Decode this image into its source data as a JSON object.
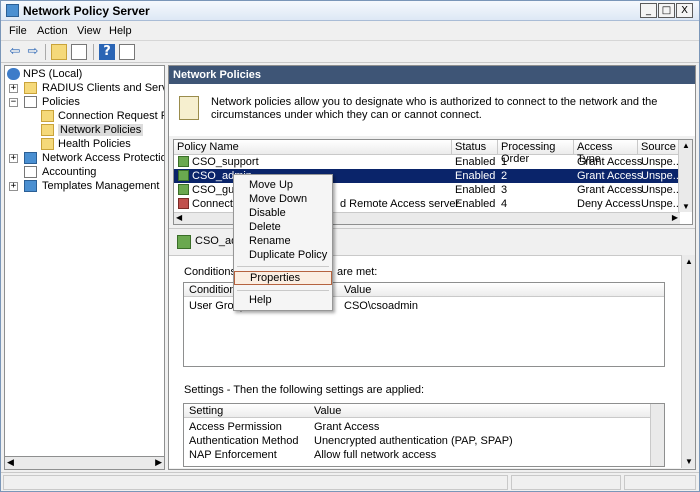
{
  "window": {
    "title": "Network Policy Server",
    "controls": [
      "_",
      "□",
      "X"
    ]
  },
  "menu": [
    "File",
    "Action",
    "View",
    "Help"
  ],
  "tree": {
    "items": [
      {
        "label": "NPS (Local)"
      },
      {
        "label": "RADIUS Clients and Servers"
      },
      {
        "label": "Policies"
      },
      {
        "label": "Connection Request Polici"
      },
      {
        "label": "Network Policies"
      },
      {
        "label": "Health Policies"
      },
      {
        "label": "Network Access Protection"
      },
      {
        "label": "Accounting"
      },
      {
        "label": "Templates Management"
      }
    ]
  },
  "main": {
    "header": "Network Policies",
    "description": "Network policies allow you to designate who is authorized to connect to the network and the circumstances under which they can or cannot connect.",
    "columns": [
      "Policy Name",
      "Status",
      "Processing Order",
      "Access Type",
      "Source"
    ],
    "rows": [
      {
        "name": "CSO_support",
        "status": "Enabled",
        "order": "1",
        "access": "Grant Access",
        "source": "Unspe..."
      },
      {
        "name": "CSO_admin",
        "status": "Enabled",
        "order": "2",
        "access": "Grant Access",
        "source": "Unspe..."
      },
      {
        "name": "CSO_guest",
        "status": "Enabled",
        "order": "3",
        "access": "Grant Access",
        "source": "Unspe..."
      },
      {
        "name": "Connection",
        "name_tail": "d Remote Access server",
        "status": "Enabled",
        "order": "4",
        "access": "Deny Access",
        "source": "Unspe..."
      }
    ],
    "detail": {
      "title": "CSO_adm",
      "conditions_label_tail": "are met:",
      "conditions_prefix": "Conditions -",
      "conditions_columns": [
        "Condition",
        "Value"
      ],
      "conditions_rows": [
        {
          "condition": "User Groups",
          "value": "CSO\\csoadmin"
        }
      ],
      "settings_label": "Settings - Then the following settings are applied:",
      "settings_columns": [
        "Setting",
        "Value"
      ],
      "settings_rows": [
        {
          "setting": "Access Permission",
          "value": "Grant Access"
        },
        {
          "setting": "Authentication Method",
          "value": "Unencrypted authentication (PAP, SPAP)"
        },
        {
          "setting": "NAP Enforcement",
          "value": "Allow full network access"
        }
      ]
    }
  },
  "context_menu": {
    "items": [
      "Move Up",
      "Move Down",
      "Disable",
      "Delete",
      "Rename",
      "Duplicate Policy",
      "Properties",
      "Help"
    ],
    "highlighted": "Properties"
  },
  "colors": {
    "header_bg": "#3e5576",
    "selection": "#0a246a",
    "highlight_border": "#b5633f"
  }
}
